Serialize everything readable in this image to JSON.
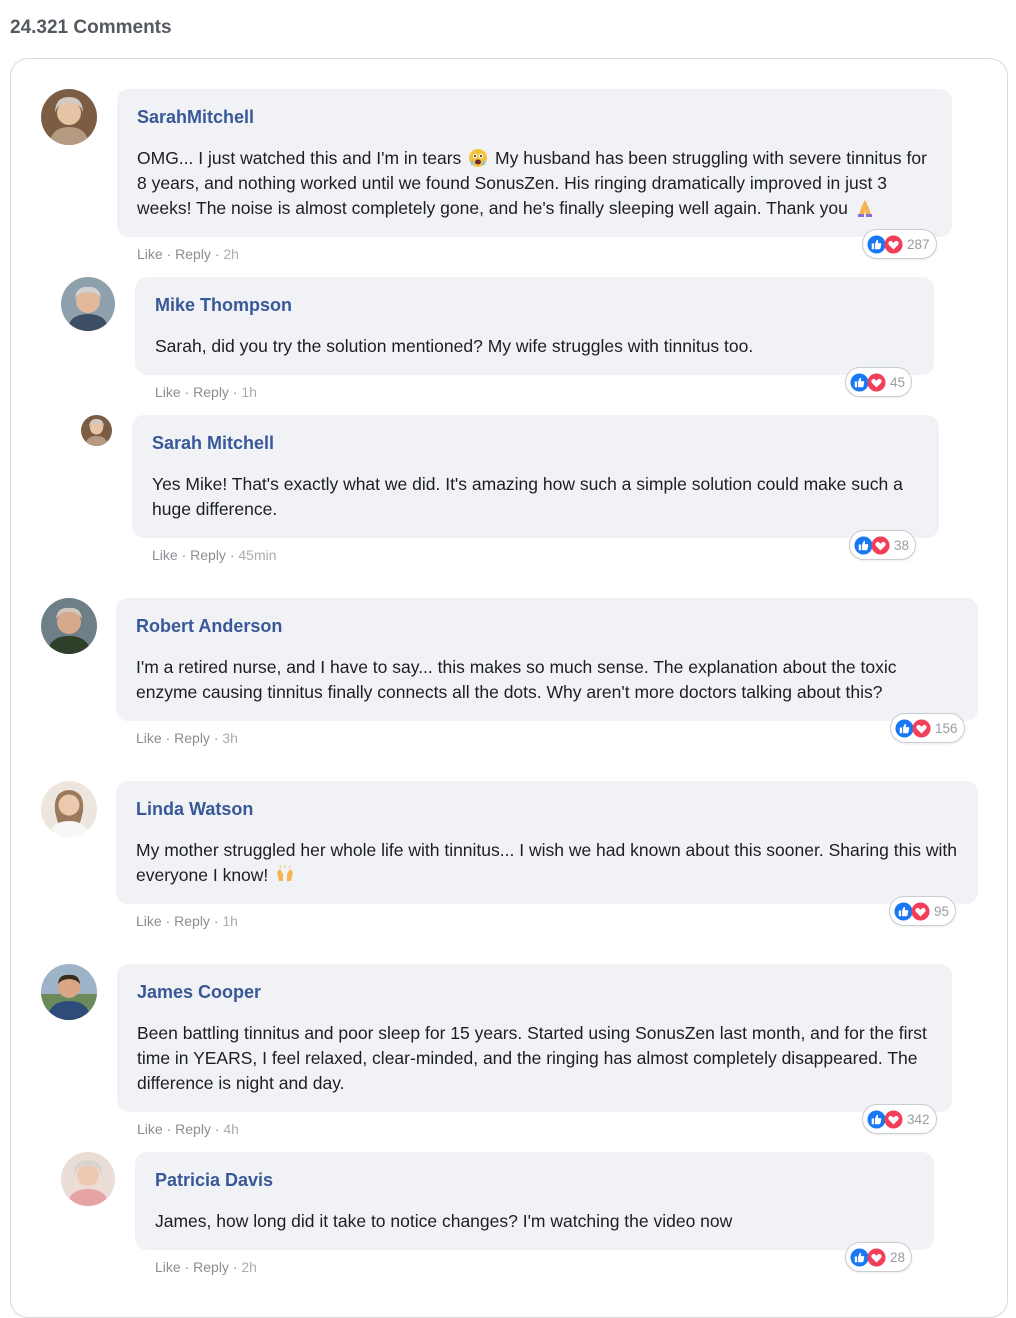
{
  "header": {
    "comment_count": "24.321 Comments"
  },
  "actions": {
    "like": "Like",
    "reply": "Reply",
    "sep": "·"
  },
  "comments": [
    {
      "name": "SarahMitchell",
      "text_a": "OMG... I just watched this and I'm in tears",
      "text_b": " My husband has been struggling with severe tinnitus for 8 years, and nothing worked until we found SonusZen. His ringing dramatically improved in just 3 weeks! The noise is almost completely gone, and he's finally sleeping well again. Thank you",
      "emoji_1": "crying-face",
      "emoji_2": "folded-hands",
      "time": "2h",
      "reactions": "287",
      "avatar_color": "#8a6a52"
    },
    {
      "name": "Mike Thompson",
      "text": "Sarah, did you try the solution mentioned? My wife struggles with tinnitus too.",
      "time": "1h",
      "reactions": "45",
      "avatar_color": "#6f7b86"
    },
    {
      "name": "Sarah Mitchell",
      "text": "Yes Mike! That's exactly what we did. It's amazing how such a simple solution could make such a huge difference.",
      "time": "45min",
      "reactions": "38",
      "avatar_color": "#8a6a52"
    },
    {
      "name": "Robert Anderson",
      "text": "I'm a retired nurse, and I have to say... this makes so much sense. The explanation about the toxic enzyme causing tinnitus finally connects all the dots. Why aren't more doctors talking about this?",
      "time": "3h",
      "reactions": "156",
      "avatar_color": "#5d6a58"
    },
    {
      "name": "Linda Watson",
      "text": "My mother struggled her whole life with tinnitus... I wish we had known about this sooner. Sharing this with everyone I know!",
      "emoji_1": "raising-hands",
      "time": "1h",
      "reactions": "95",
      "avatar_color": "#c9b8a6"
    },
    {
      "name": "James Cooper",
      "text": "Been battling tinnitus and poor sleep for 15 years. Started using SonusZen last month, and for the first time in YEARS, I feel relaxed, clear-minded, and the ringing has almost completely disappeared. The difference is night and day.",
      "time": "4h",
      "reactions": "342",
      "avatar_color": "#3f5f8a"
    },
    {
      "name": "Patricia Davis",
      "text": "James, how long did it take to notice changes? I'm watching the video now",
      "time": "2h",
      "reactions": "28",
      "avatar_color": "#d9b7a8"
    }
  ],
  "colors": {
    "name": "#385898",
    "bubble": "#f0f2f5",
    "like_blue": "#1877f2",
    "love_red": "#f33e58"
  }
}
